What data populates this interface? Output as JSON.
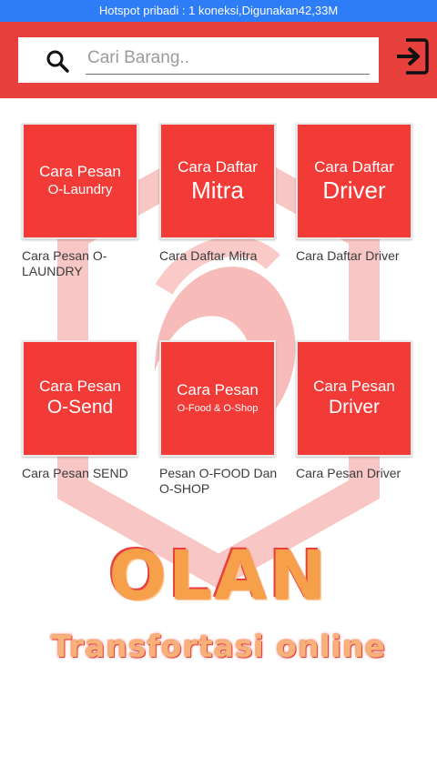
{
  "status_bar": {
    "text": "Hotspot pribadi : 1 koneksi,Digunakan42,33M"
  },
  "header": {
    "search_placeholder": "Cari Barang..",
    "search_icon": "search-icon",
    "logout_icon": "logout-icon",
    "accent_color": "#e8403c"
  },
  "menu": [
    {
      "line1": "Cara Pesan",
      "line2": "O-Laundry",
      "caption": "Cara Pesan O-LAUNDRY"
    },
    {
      "line1": "Cara Daftar",
      "line2": "Mitra",
      "caption": "Cara Daftar Mitra"
    },
    {
      "line1": "Cara Daftar",
      "line2": "Driver",
      "caption": "Cara Daftar Driver"
    },
    {
      "line1": "Cara Pesan",
      "line2": "O-Send",
      "caption": "Cara Pesan SEND"
    },
    {
      "line1": "Cara Pesan",
      "line2": "O-Food & O-Shop",
      "caption": "Pesan O-FOOD Dan O-SHOP"
    },
    {
      "line1": "Cara Pesan",
      "line2": "Driver",
      "caption": "Cara Pesan Driver"
    }
  ],
  "brand": {
    "title": "OLAN",
    "subtitle": "Transfortasi online"
  }
}
